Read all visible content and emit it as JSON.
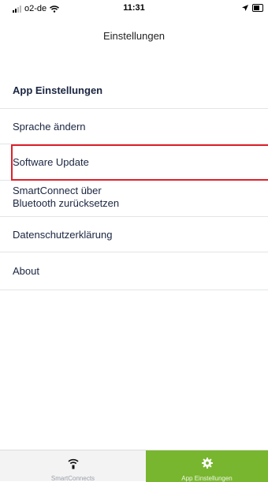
{
  "status_bar": {
    "carrier": "o2-de",
    "time": "11:31"
  },
  "nav": {
    "title": "Einstellungen"
  },
  "section": {
    "header": "App Einstellungen"
  },
  "menu": {
    "items": [
      {
        "label": "Sprache ändern"
      },
      {
        "label": "Software Update"
      },
      {
        "label_line1": "SmartConnect über",
        "label_line2": "Bluetooth zurücksetzen"
      },
      {
        "label": "Datenschutzerklärung"
      },
      {
        "label": "About"
      }
    ]
  },
  "tab_bar": {
    "tabs": [
      {
        "label": "SmartConnects",
        "icon": "wifi-icon"
      },
      {
        "label": "App Einstellungen",
        "icon": "gear-icon",
        "active": true
      }
    ],
    "active_color": "#78b62f"
  },
  "colors": {
    "highlight": "#e0202a",
    "text": "#1a2540"
  }
}
